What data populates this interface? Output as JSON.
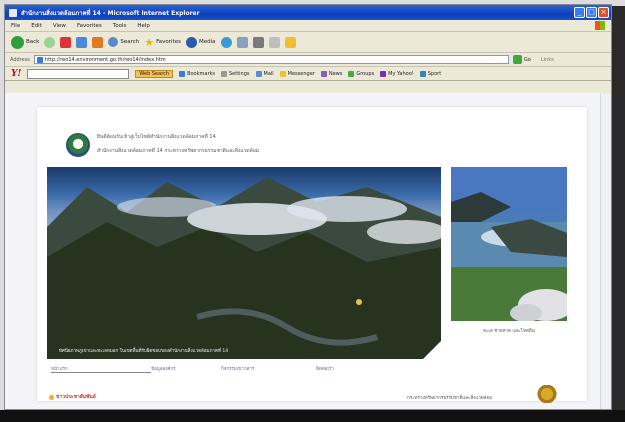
{
  "window": {
    "title": "สำนักงานสิ่งแวดล้อมภาคที่ 14 - Microsoft Internet Explorer",
    "controls": [
      "_",
      "□",
      "×"
    ]
  },
  "menu": [
    "File",
    "Edit",
    "View",
    "Favorites",
    "Tools",
    "Help"
  ],
  "toolbar": {
    "back_label": "Back",
    "search_label": "Search",
    "favorites_label": "Favorites",
    "media_label": "Media"
  },
  "address": {
    "label": "Address",
    "value": "http://reo14.environment.go.th/reo14/index.htm",
    "go_label": "Go",
    "links_label": "Links"
  },
  "yahoo_toolbar": {
    "logo": "Y!",
    "web_search": "Web Search",
    "items": [
      "Bookmarks",
      "Settings",
      "Mail",
      "Messenger",
      "News",
      "Groups",
      "My Yahoo!",
      "Sport"
    ]
  },
  "page": {
    "header_line1": "ยินดีต้อนรับเข้าสู่เว็บไซต์สำนักงานสิ่งแวดล้อมภาคที่ 14",
    "header_line2": "สำนักงานสิ่งแวดล้อมภาคที่ 14 กระทรวงทรัพยากรธรรมชาติและสิ่งแวดล้อม",
    "hero_caption": "ทัศนียภาพภูเขาและทะเลหมอก ในเขตพื้นที่รับผิดชอบของสำนักงานสิ่งแวดล้อมภาคที่ 14",
    "side_caption": "ทะเล ชายหาด และโขดหิน",
    "nav": [
      "หน้าแรก",
      "ข้อมูลองค์กร",
      "กิจกรรม/ข่าวสาร",
      "ติดต่อเรา"
    ],
    "footer_left": "ข่าวประชาสัมพันธ์",
    "footer_right": "กระทรวงทรัพยากรธรรมชาติและสิ่งแวดล้อม"
  },
  "colors": {
    "title_bar": "#0d3fb8",
    "yahoo_red": "#d2001e",
    "link": "#6a6a9a"
  }
}
